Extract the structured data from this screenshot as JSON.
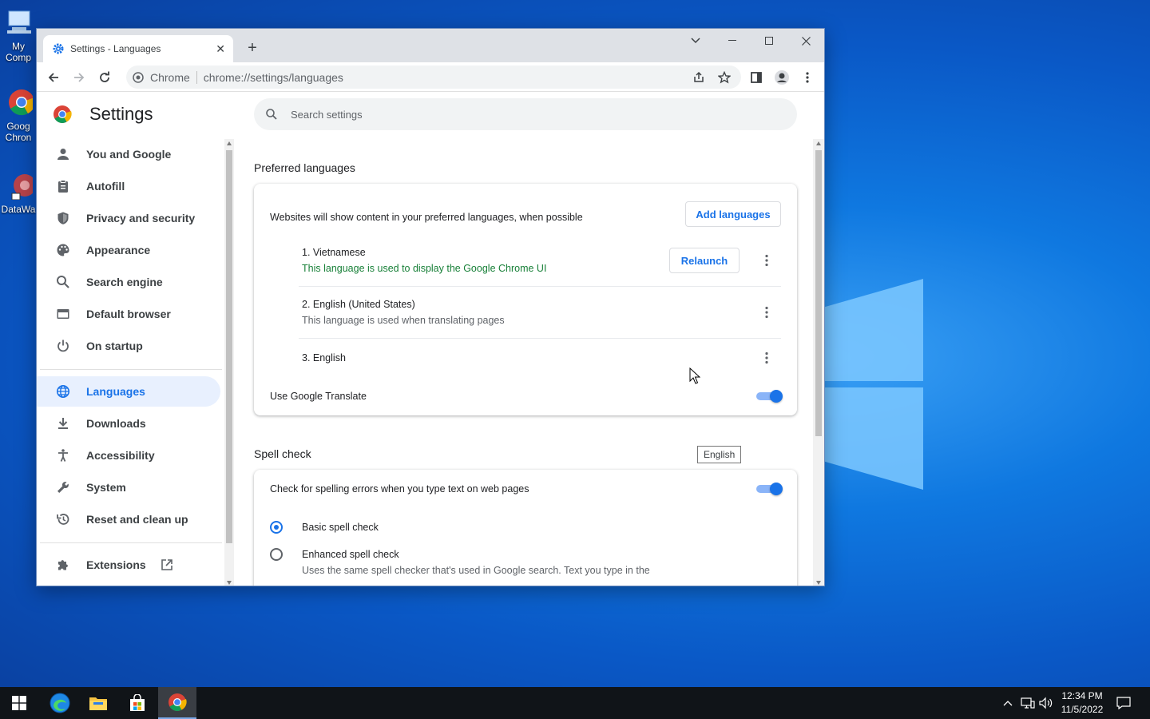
{
  "desktop": {
    "icons": [
      {
        "label": "My Comp",
        "icon": "computer-icon"
      },
      {
        "label": "Goog Chron",
        "icon": "chrome-shortcut-icon"
      },
      {
        "label": "DataWa",
        "icon": "datawa-shortcut-icon"
      }
    ]
  },
  "browser": {
    "tab_title": "Settings - Languages",
    "site_label": "Chrome",
    "url": "chrome://settings/languages"
  },
  "settings": {
    "title": "Settings",
    "search_placeholder": "Search settings",
    "nav": [
      {
        "label": "You and Google",
        "icon": "person-icon"
      },
      {
        "label": "Autofill",
        "icon": "clipboard-icon"
      },
      {
        "label": "Privacy and security",
        "icon": "shield-icon"
      },
      {
        "label": "Appearance",
        "icon": "palette-icon"
      },
      {
        "label": "Search engine",
        "icon": "search-icon"
      },
      {
        "label": "Default browser",
        "icon": "browser-window-icon"
      },
      {
        "label": "On startup",
        "icon": "power-icon"
      },
      {
        "label": "Languages",
        "icon": "globe-icon",
        "active": true
      },
      {
        "label": "Downloads",
        "icon": "download-icon"
      },
      {
        "label": "Accessibility",
        "icon": "accessibility-icon"
      },
      {
        "label": "System",
        "icon": "wrench-icon"
      },
      {
        "label": "Reset and clean up",
        "icon": "restore-icon"
      },
      {
        "label": "Extensions",
        "icon": "puzzle-icon"
      }
    ]
  },
  "languages": {
    "section_title": "Preferred languages",
    "intro": "Websites will show content in your preferred languages, when possible",
    "add_button": "Add languages",
    "items": [
      {
        "name": "1. Vietnamese",
        "note": "This language is used to display the Google Chrome UI",
        "button": "Relaunch"
      },
      {
        "name": "2. English (United States)",
        "note": "This language is used when translating pages"
      },
      {
        "name": "3. English"
      }
    ],
    "translate_label": "Use Google Translate",
    "translate_on": true,
    "tooltip": "English"
  },
  "spellcheck": {
    "section_title": "Spell check",
    "check_label": "Check for spelling errors when you type text on web pages",
    "check_on": true,
    "basic_label": "Basic spell check",
    "enhanced_label": "Enhanced spell check",
    "enhanced_desc": "Uses the same spell checker that's used in Google search. Text you type in the",
    "selected": "basic"
  },
  "taskbar": {
    "time": "12:34 PM",
    "date": "11/5/2022"
  },
  "colors": {
    "accent": "#1a73e8",
    "green_text": "#188038",
    "active_nav_bg": "#e8f0fe"
  }
}
